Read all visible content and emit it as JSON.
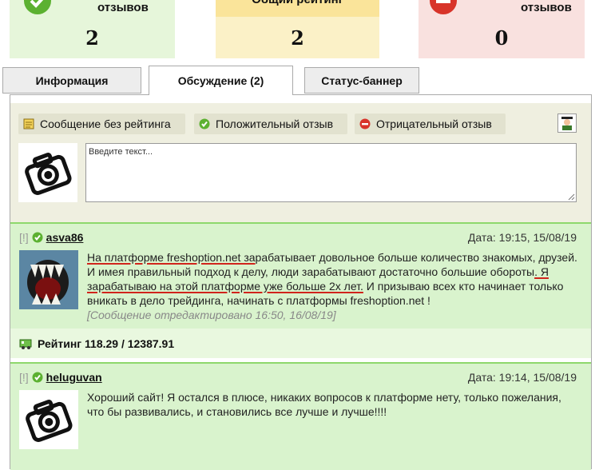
{
  "stats": {
    "positive": {
      "label": "отзывов",
      "value": "2"
    },
    "total": {
      "label": "Общий рейтинг",
      "value": "2"
    },
    "negative": {
      "label": "отзывов",
      "value": "0"
    }
  },
  "tabs": [
    {
      "label": "Информация"
    },
    {
      "label": "Обсуждение (2)"
    },
    {
      "label": "Статус-баннер"
    }
  ],
  "composer": {
    "buttons": [
      {
        "label": "Сообщение без рейтинга",
        "icon": "note-icon"
      },
      {
        "label": "Положительный отзыв",
        "icon": "check-circle-icon"
      },
      {
        "label": "Отрицательный отзыв",
        "icon": "minus-circle-icon"
      }
    ],
    "placeholder": "Введите текст..."
  },
  "posts": [
    {
      "flag": "[!]",
      "user": "asva86",
      "date": "Дата: 19:15, 15/08/19",
      "text_parts": [
        "На платформе freshoption.net за",
        "рабатывает довольное больше количество знакомых, друзей. И имея правильный подход к делу, люди зарабатывают достаточно большие обороты",
        ". Я зарабатываю на этой платформе уже больше 2х лет.",
        " И призываю всех кто начинает только вникать в дело трейдинга, начинать с платформы freshoption.net !"
      ],
      "edited": "[Сообщение отредактировано 16:50, 16/08/19]",
      "rating": "Рейтинг 118.29 / 12387.91"
    },
    {
      "flag": "[!]",
      "user": "heluguvan",
      "date": "Дата: 19:14, 15/08/19",
      "text": "Хороший сайт! Я остался в плюсе, никаких вопросов к платформе нету, только пожелания, что бы развивались, и становились все лучше и лучше!!!!"
    }
  ],
  "colors": {
    "positive": "#8ed86c",
    "negative": "#d8342a",
    "accent": "#d0241c"
  }
}
